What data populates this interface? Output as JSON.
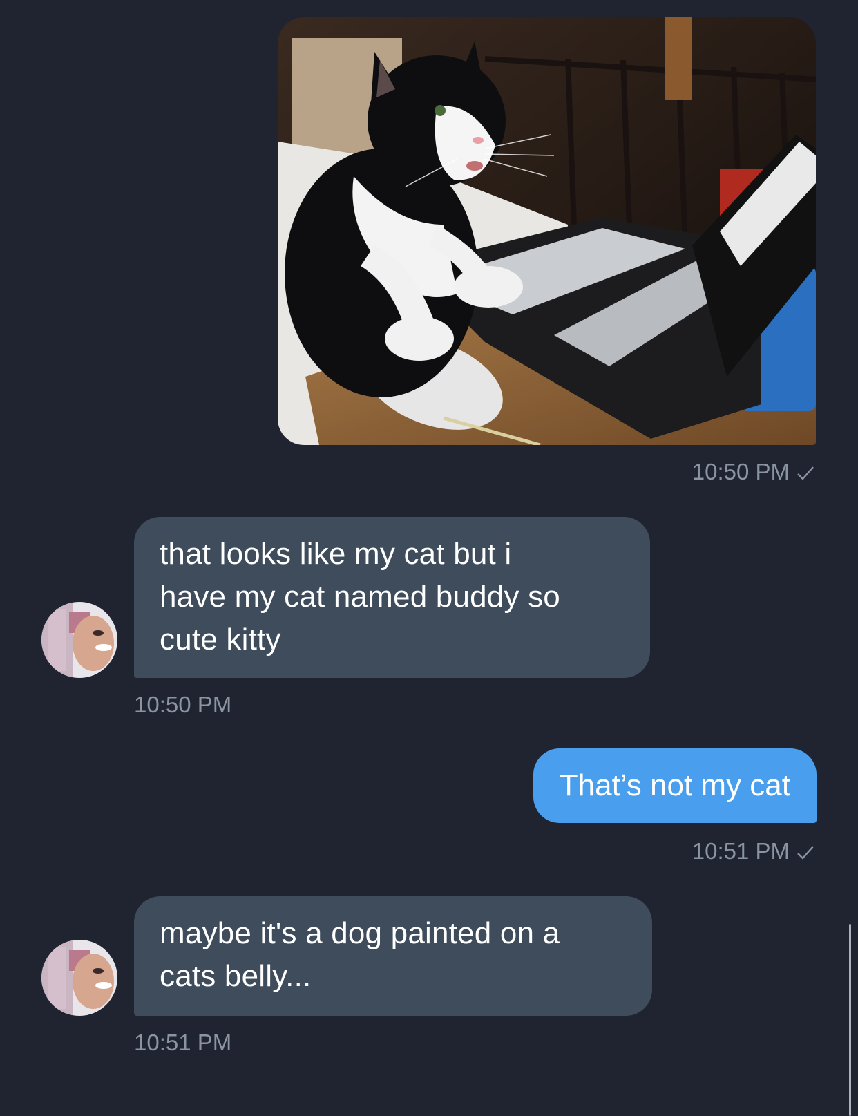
{
  "conversation": {
    "messages": [
      {
        "direction": "outgoing",
        "type": "image",
        "image_alt": "cat with laptop and mouse",
        "time": "10:50 PM",
        "status": "sent"
      },
      {
        "direction": "incoming",
        "type": "text",
        "lines": [
          "that looks like my cat but i",
          "have my cat named buddy so",
          "cute kitty"
        ],
        "time": "10:50 PM"
      },
      {
        "direction": "outgoing",
        "type": "text",
        "text": "That’s not my cat",
        "time": "10:51 PM",
        "status": "sent"
      },
      {
        "direction": "incoming",
        "type": "text",
        "lines": [
          "maybe it's a dog painted on a",
          "cats belly..."
        ],
        "time": "10:51 PM"
      }
    ]
  },
  "icons": {
    "read_receipt": "checkmark-icon",
    "avatar": "avatar"
  },
  "colors": {
    "background": "#1f2430",
    "incoming_bubble": "#3e4c5c",
    "outgoing_bubble": "#4a9eee",
    "timestamp": "#8a94a2"
  }
}
